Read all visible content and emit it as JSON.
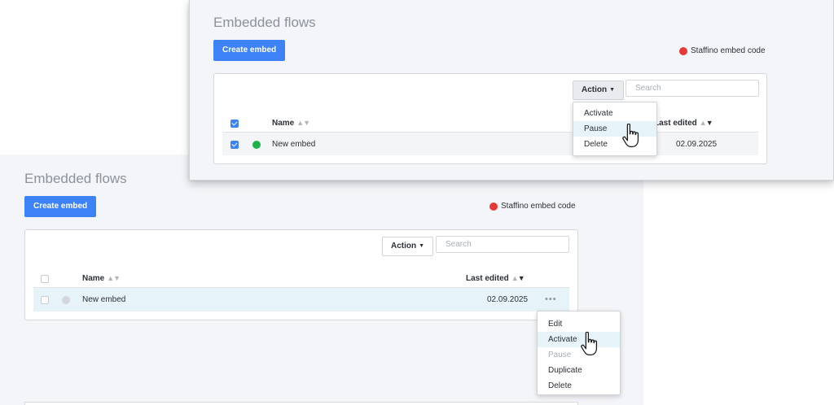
{
  "back": {
    "title": "Embedded flows",
    "create_label": "Create embed",
    "embed_code_label": "Staffino embed code",
    "action_label": "Action",
    "search_placeholder": "Search",
    "columns": {
      "name": "Name",
      "last_edited": "Last edited"
    },
    "row": {
      "name": "New embed",
      "date": "02.09.2025",
      "more": "•••"
    },
    "menu": [
      {
        "label": "Edit",
        "state": "normal"
      },
      {
        "label": "Activate",
        "state": "hover"
      },
      {
        "label": "Pause",
        "state": "disabled"
      },
      {
        "label": "Duplicate",
        "state": "normal"
      },
      {
        "label": "Delete",
        "state": "normal"
      }
    ]
  },
  "front": {
    "title": "Embedded flows",
    "create_label": "Create embed",
    "embed_code_label": "Staffino embed code",
    "action_label": "Action",
    "search_placeholder": "Search",
    "columns": {
      "name": "Name",
      "last_edited": "Last edited"
    },
    "row": {
      "name": "New embed",
      "date": "02.09.2025"
    },
    "action_menu": [
      {
        "label": "Activate",
        "state": "normal"
      },
      {
        "label": "Pause",
        "state": "hover"
      },
      {
        "label": "Delete",
        "state": "normal"
      }
    ]
  },
  "colors": {
    "primary": "#3d82f6",
    "status_active": "#20b14c",
    "status_inactive": "#d3d6db",
    "embed_dot": "#e53935",
    "row_highlight": "#e6f3f9"
  },
  "icons": {
    "cursor": "pointer-hand-icon",
    "sort": "sort-arrows-icon",
    "caret": "caret-down-icon"
  }
}
